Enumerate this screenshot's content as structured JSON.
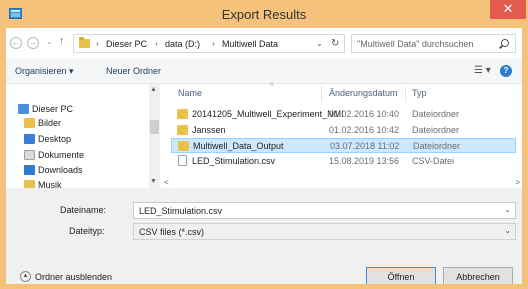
{
  "window": {
    "title": "Export Results",
    "close_glyph": "✕",
    "frame_color": "#f4c27a",
    "close_color": "#e35b4f"
  },
  "address": {
    "back_glyph": "←",
    "forward_glyph": "→",
    "recent_glyph": "⌄",
    "up_glyph": "↑",
    "separator": "›",
    "breadcrumbs": [
      "Dieser PC",
      "data (D:)",
      "Multiwell Data"
    ],
    "dropdown_glyph": "⌄",
    "refresh_glyph": "↻"
  },
  "search": {
    "placeholder": "\"Multiwell Data\" durchsuchen"
  },
  "toolbar": {
    "organize_label": "Organisieren ▾",
    "new_folder_label": "Neuer Ordner",
    "view_glyph": "☰ ▾",
    "help_glyph": "?"
  },
  "nav": {
    "items": [
      {
        "label": "Dieser PC",
        "icon": "computer-icon"
      },
      {
        "label": "Bilder",
        "icon": "pictures-folder-icon"
      },
      {
        "label": "Desktop",
        "icon": "desktop-folder-icon"
      },
      {
        "label": "Dokumente",
        "icon": "documents-folder-icon"
      },
      {
        "label": "Downloads",
        "icon": "downloads-folder-icon"
      },
      {
        "label": "Musik",
        "icon": "music-folder-icon"
      }
    ],
    "scroll_up": "▲",
    "scroll_down": "▼"
  },
  "files": {
    "columns": {
      "name": "Name",
      "date": "Änderungsdatum",
      "type": "Typ"
    },
    "sort_glyph": "^",
    "rows": [
      {
        "name": "20141205_Multiwell_Experiment_NMI",
        "date": "01.02.2016 10:40",
        "type": "Dateiordner",
        "icon": "folder-icon",
        "selected": false
      },
      {
        "name": "Janssen",
        "date": "01.02.2016 10:42",
        "type": "Dateiordner",
        "icon": "folder-icon",
        "selected": false
      },
      {
        "name": "Multiwell_Data_Output",
        "date": "03.07.2018 11:02",
        "type": "Dateiordner",
        "icon": "folder-icon",
        "selected": true
      },
      {
        "name": "LED_Stimulation.csv",
        "date": "15.08.2019 13:56",
        "type": "CSV-Datei",
        "icon": "csv-file-icon",
        "selected": false
      }
    ],
    "scroll_left": "<",
    "scroll_right": ">"
  },
  "form": {
    "filename_label": "Dateiname:",
    "filename_value": "LED_Stimulation.csv",
    "filetype_label": "Dateityp:",
    "filetype_value": "CSV files (*.csv)",
    "dropdown_glyph": "⌄",
    "hide_folders_label": "Ordner ausblenden",
    "hide_glyph": "▲",
    "open_button": "Öffnen",
    "cancel_button": "Abbrechen"
  }
}
